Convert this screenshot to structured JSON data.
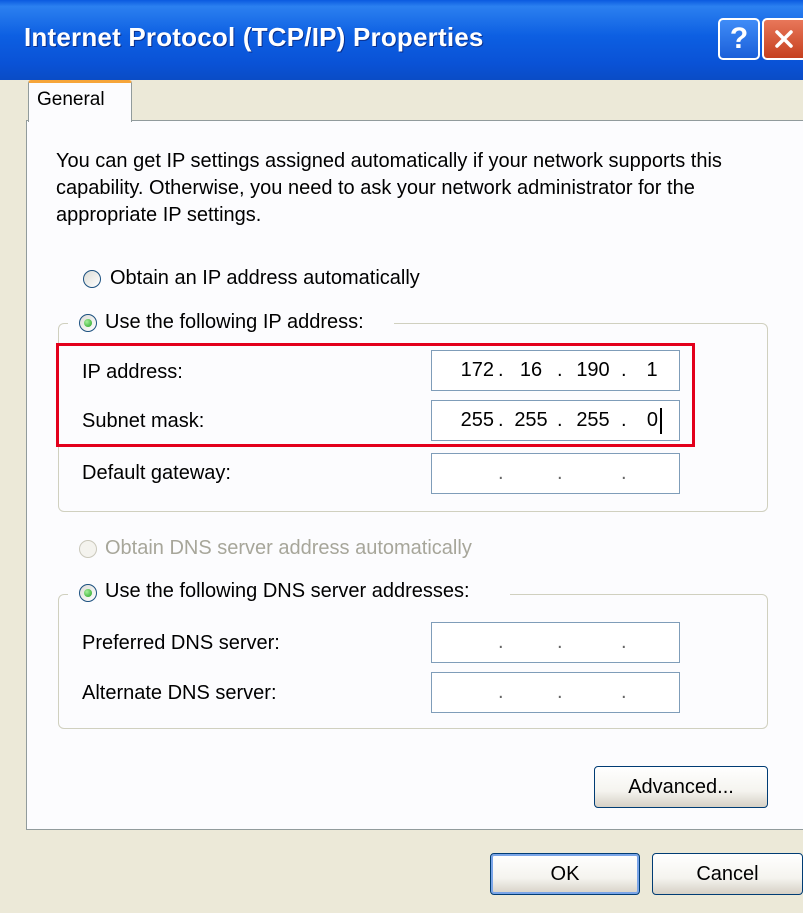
{
  "window": {
    "title": "Internet Protocol (TCP/IP) Properties",
    "help_label": "?"
  },
  "tabs": [
    {
      "label": "General",
      "selected": true
    }
  ],
  "description": "You can get IP settings assigned automatically if your network supports this capability. Otherwise, you need to ask your network administrator for the appropriate IP settings.",
  "ip": {
    "auto_label": "Obtain an IP address automatically",
    "manual_label": "Use the following IP address:",
    "selected": "manual",
    "fields": [
      {
        "label": "IP address:",
        "octets": [
          "172",
          "16",
          "190",
          "1"
        ]
      },
      {
        "label": "Subnet mask:",
        "octets": [
          "255",
          "255",
          "255",
          "0"
        ]
      },
      {
        "label": "Default gateway:",
        "octets": [
          "",
          "",
          "",
          ""
        ]
      }
    ]
  },
  "dns": {
    "auto_label": "Obtain DNS server address automatically",
    "manual_label": "Use the following DNS server addresses:",
    "selected": "manual",
    "auto_disabled": true,
    "fields": [
      {
        "label": "Preferred DNS server:",
        "octets": [
          "",
          "",
          "",
          ""
        ]
      },
      {
        "label": "Alternate DNS server:",
        "octets": [
          "",
          "",
          "",
          ""
        ]
      }
    ]
  },
  "buttons": {
    "advanced": "Advanced...",
    "ok": "OK",
    "cancel": "Cancel"
  },
  "colors": {
    "titlebar": "#0a5ae0",
    "highlight": "#e3001b",
    "tab_accent": "#f6a53a",
    "dialog_bg": "#ece9d8"
  }
}
